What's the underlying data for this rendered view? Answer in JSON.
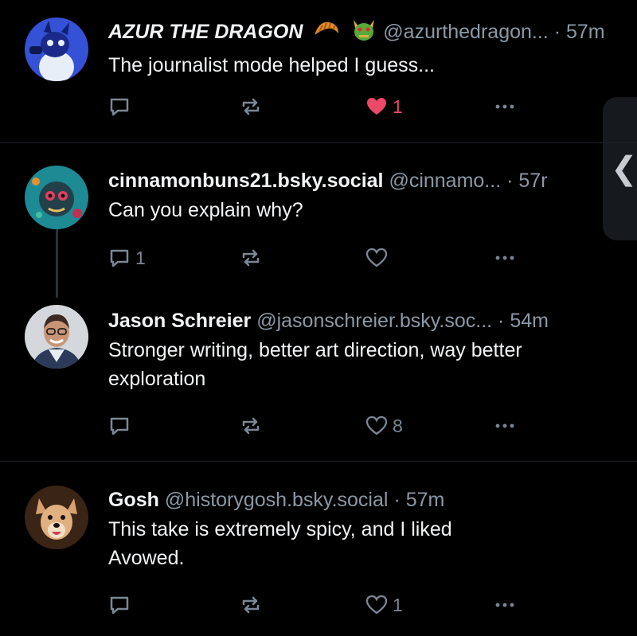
{
  "colors": {
    "background": "#000000",
    "muted": "#8b98a5",
    "like_active": "#ec4868"
  },
  "posts": [
    {
      "display_name": "AZUR THE DRAGON",
      "emojis": [
        "croissant-emoji",
        "dragon-face-emoji"
      ],
      "handle": "@azurthedragon...",
      "separator": "·",
      "time": "57m",
      "text": "The journalist mode helped I guess...",
      "reply_count": "",
      "repost_count": "",
      "like_count": "1",
      "liked": true
    },
    {
      "display_name": "cinnamonbuns21.bsky.social",
      "handle": "@cinnamo...",
      "separator": "·",
      "time": "57r",
      "text": "Can you explain why?",
      "reply_count": "1",
      "repost_count": "",
      "like_count": "",
      "liked": false
    },
    {
      "display_name": "Jason Schreier",
      "handle": "@jasonschreier.bsky.soc...",
      "separator": "·",
      "time": "54m",
      "text": "Stronger writing, better art direction, way better exploration",
      "reply_count": "",
      "repost_count": "",
      "like_count": "8",
      "liked": false
    },
    {
      "display_name": "Gosh",
      "handle": "@historygosh.bsky.social",
      "separator": "·",
      "time": "57m",
      "text": "This take is extremely spicy, and I liked Avowed.",
      "reply_count": "",
      "repost_count": "",
      "like_count": "1",
      "liked": false
    }
  ],
  "side_tab": {
    "icon": "chevron-left-icon",
    "glyph": "❮"
  }
}
